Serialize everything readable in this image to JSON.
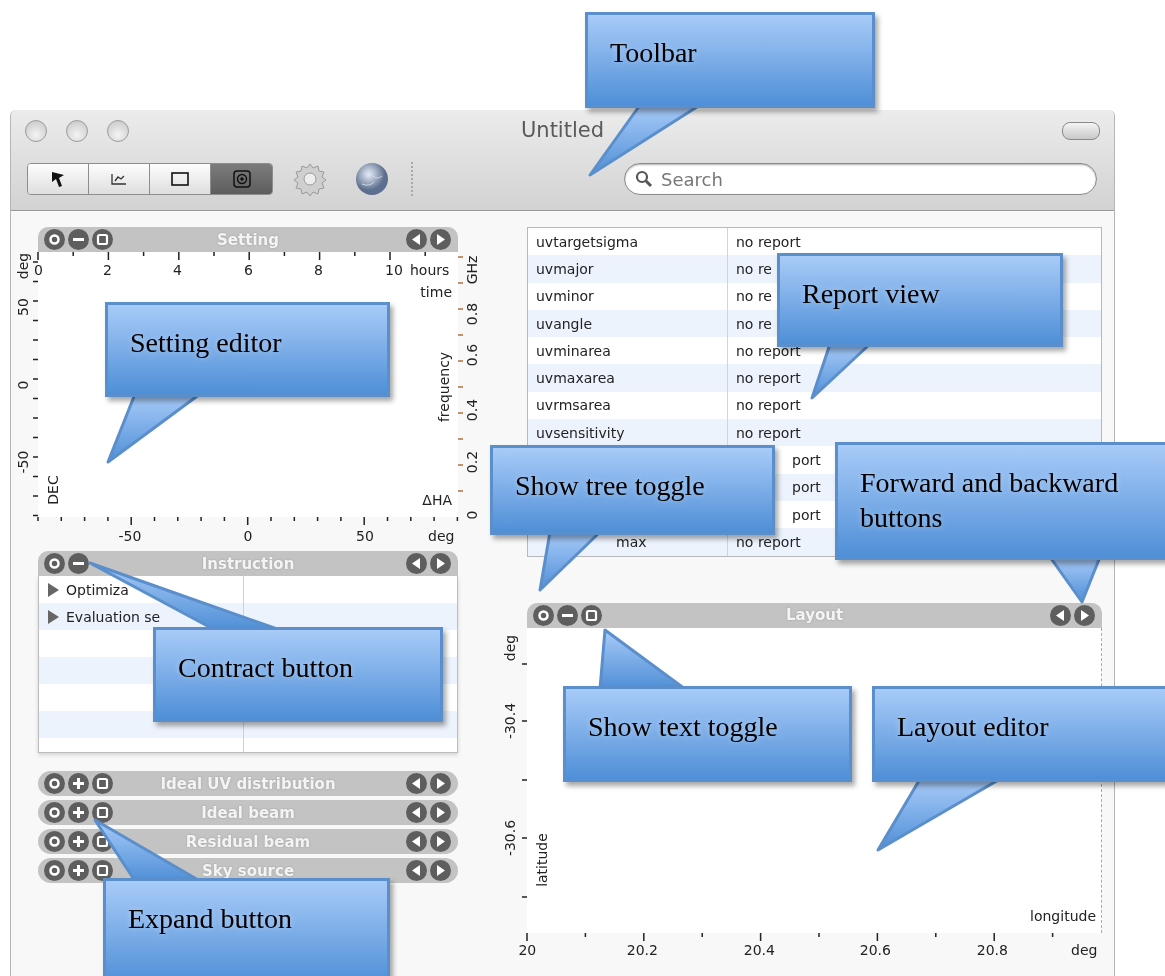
{
  "window": {
    "title": "Untitled"
  },
  "toolbar": {
    "segments": [
      {
        "kind": "pointer",
        "selected": false
      },
      {
        "kind": "chart",
        "selected": false
      },
      {
        "kind": "rectangle",
        "selected": false
      },
      {
        "kind": "target",
        "selected": true
      }
    ],
    "search": {
      "placeholder": "Search"
    }
  },
  "setting": {
    "title": "Setting",
    "expanded": true,
    "text_toggle": true,
    "top_axis": {
      "ticks": [
        "0",
        "2",
        "4",
        "6",
        "8",
        "10"
      ],
      "unit": "hours",
      "label": "time"
    },
    "left_axis": {
      "unit": "deg",
      "ticks": [
        "50",
        "0",
        "-50"
      ],
      "label": "DEC"
    },
    "right_axis": {
      "unit": "GHz",
      "ticks": [
        "0.8",
        "0.6",
        "0.4",
        "0.2",
        "0"
      ],
      "label": "frequency"
    },
    "bottom_axis": {
      "ticks": [
        "-50",
        "0",
        "50"
      ],
      "unit": "deg",
      "label": "ΔHA"
    }
  },
  "instruction": {
    "title": "Instruction",
    "expanded": true,
    "rows": [
      {
        "label": "Optimiza",
        "expanded": false
      },
      {
        "label": "Evaluation se",
        "expanded": false
      }
    ]
  },
  "collapsed_panels": [
    {
      "title": "Ideal UV distribution",
      "expanded": false,
      "text_toggle": true
    },
    {
      "title": "Ideal beam",
      "expanded": false,
      "text_toggle": true
    },
    {
      "title": "Residual beam",
      "expanded": false,
      "text_toggle": true
    },
    {
      "title": "Sky source",
      "expanded": false,
      "text_toggle": true
    }
  ],
  "report": {
    "rows": [
      {
        "name": "uvtargetsigma",
        "value": "no report"
      },
      {
        "name": "uvmajor",
        "value": "no re"
      },
      {
        "name": "uvminor",
        "value": "no re"
      },
      {
        "name": "uvangle",
        "value": "no re"
      },
      {
        "name": "uvminarea",
        "value": "no report"
      },
      {
        "name": "uvmaxarea",
        "value": "no report"
      },
      {
        "name": "uvrmsarea",
        "value": "no report"
      },
      {
        "name": "uvsensitivity",
        "value": "no report"
      },
      {
        "value": "port"
      },
      {
        "value": "port"
      },
      {
        "value": "port"
      },
      {
        "name": "max",
        "value": "no report"
      }
    ]
  },
  "layout": {
    "title": "Layout",
    "expanded": true,
    "text_toggle": true,
    "left_axis": {
      "unit": "deg",
      "ticks": [
        "-30.4",
        "-30.6"
      ],
      "label": "latitude"
    },
    "bottom_axis": {
      "ticks": [
        "20",
        "20.2",
        "20.4",
        "20.6",
        "20.8"
      ],
      "unit": "deg",
      "label": "longitude"
    }
  },
  "callouts": [
    "Toolbar",
    "Setting editor",
    "Report view",
    "Show tree toggle",
    "Forward and backward buttons",
    "Contract button",
    "Show text toggle",
    "Layout editor",
    "Expand button"
  ]
}
